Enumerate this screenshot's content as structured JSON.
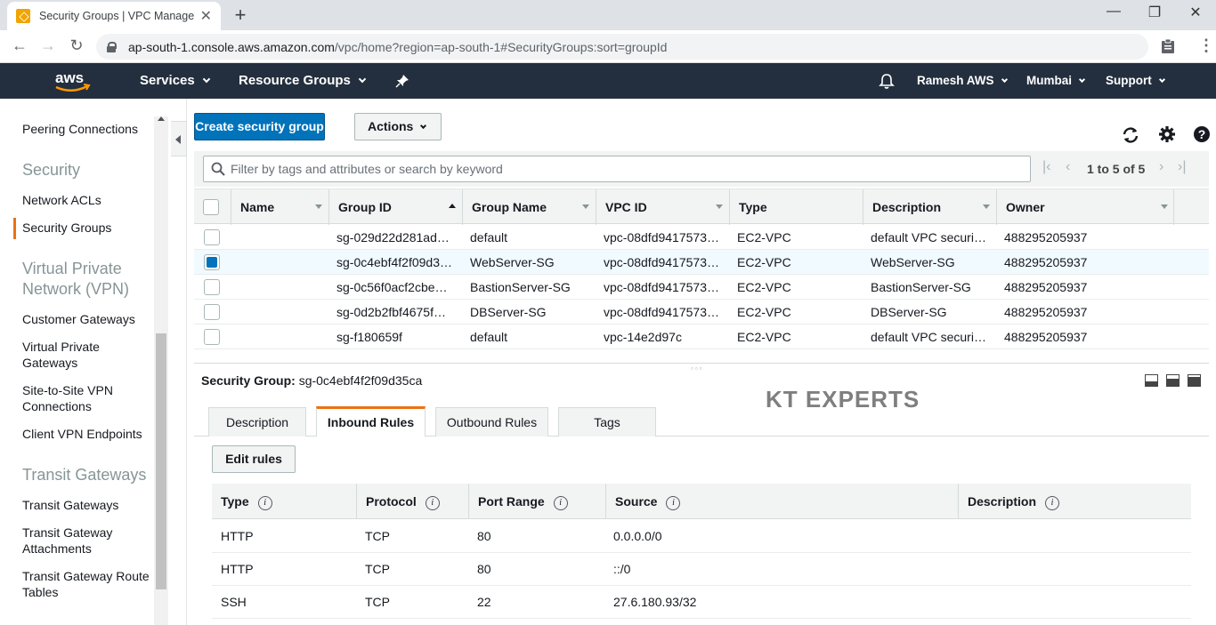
{
  "browser": {
    "tab_title": "Security Groups | VPC Management Console",
    "url_host": "ap-south-1.console.aws.amazon.com",
    "url_path": "/vpc/home?region=ap-south-1#SecurityGroups:sort=groupId"
  },
  "nav": {
    "logo": "aws",
    "services": "Services",
    "resource_groups": "Resource Groups",
    "user": "Ramesh AWS",
    "region": "Mumbai",
    "support": "Support"
  },
  "sidebar": {
    "peering": "Peering Connections",
    "security_head": "Security",
    "network_acls": "Network ACLs",
    "security_groups": "Security Groups",
    "vpn_head": "Virtual Private Network (VPN)",
    "customer_gateways": "Customer Gateways",
    "virtual_private_gateways": "Virtual Private Gateways",
    "site_to_site": "Site-to-Site VPN Connections",
    "client_vpn": "Client VPN Endpoints",
    "transit_head": "Transit Gateways",
    "transit_gateways": "Transit Gateways",
    "transit_attachments": "Transit Gateway Attachments",
    "transit_route_tables": "Transit Gateway Route Tables"
  },
  "toolbar": {
    "create": "Create security group",
    "actions": "Actions"
  },
  "search": {
    "placeholder": "Filter by tags and attributes or search by keyword"
  },
  "pagination": {
    "text": "1 to 5 of 5"
  },
  "table": {
    "headers": {
      "name": "Name",
      "group_id": "Group ID",
      "group_name": "Group Name",
      "vpc_id": "VPC ID",
      "type": "Type",
      "description": "Description",
      "owner": "Owner"
    },
    "rows": [
      {
        "name": "",
        "group_id": "sg-029d22d281ad…",
        "group_name": "default",
        "vpc_id": "vpc-08dfd9417573…",
        "type": "EC2-VPC",
        "description": "default VPC securi…",
        "owner": "488295205937"
      },
      {
        "name": "",
        "group_id": "sg-0c4ebf4f2f09d3…",
        "group_name": "WebServer-SG",
        "vpc_id": "vpc-08dfd9417573…",
        "type": "EC2-VPC",
        "description": "WebServer-SG",
        "owner": "488295205937"
      },
      {
        "name": "",
        "group_id": "sg-0c56f0acf2cbe…",
        "group_name": "BastionServer-SG",
        "vpc_id": "vpc-08dfd9417573…",
        "type": "EC2-VPC",
        "description": "BastionServer-SG",
        "owner": "488295205937"
      },
      {
        "name": "",
        "group_id": "sg-0d2b2fbf4675f…",
        "group_name": "DBServer-SG",
        "vpc_id": "vpc-08dfd9417573…",
        "type": "EC2-VPC",
        "description": "DBServer-SG",
        "owner": "488295205937"
      },
      {
        "name": "",
        "group_id": "sg-f180659f",
        "group_name": "default",
        "vpc_id": "vpc-14e2d97c",
        "type": "EC2-VPC",
        "description": "default VPC securi…",
        "owner": "488295205937"
      }
    ]
  },
  "detail": {
    "label": "Security Group:",
    "id": "sg-0c4ebf4f2f09d35ca",
    "watermark": "KT EXPERTS",
    "tabs": [
      "Description",
      "Inbound Rules",
      "Outbound Rules",
      "Tags"
    ],
    "edit_rules": "Edit rules",
    "rule_headers": {
      "type": "Type",
      "protocol": "Protocol",
      "port_range": "Port Range",
      "source": "Source",
      "description": "Description"
    },
    "rules": [
      {
        "type": "HTTP",
        "protocol": "TCP",
        "port": "80",
        "source": "0.0.0.0/0",
        "description": ""
      },
      {
        "type": "HTTP",
        "protocol": "TCP",
        "port": "80",
        "source": "::/0",
        "description": ""
      },
      {
        "type": "SSH",
        "protocol": "TCP",
        "port": "22",
        "source": "27.6.180.93/32",
        "description": ""
      }
    ]
  },
  "colors": {
    "nav_bg": "#232f3e",
    "primary_button": "#0073bb",
    "accent": "#ec7211"
  }
}
